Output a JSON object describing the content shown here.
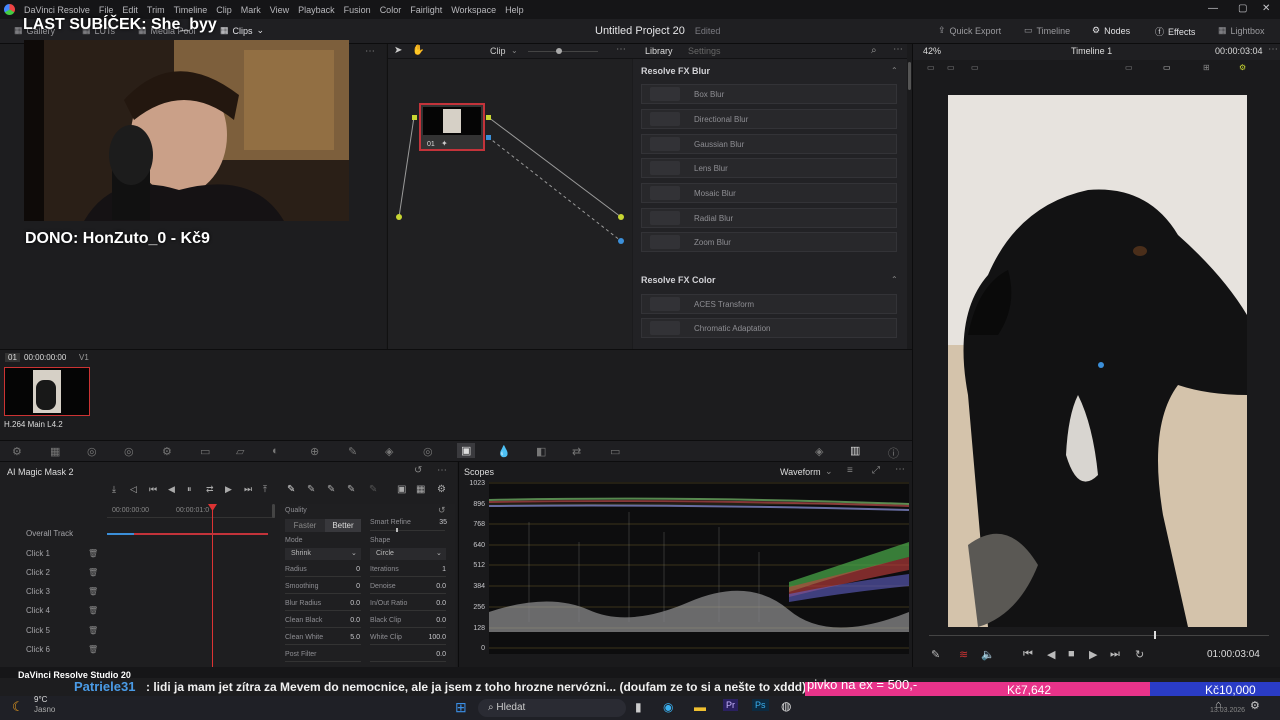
{
  "menubar": {
    "app": "DaVinci Resolve",
    "items": [
      "File",
      "Edit",
      "Trim",
      "Timeline",
      "Clip",
      "Mark",
      "View",
      "Playback",
      "Fusion",
      "Color",
      "Fairlight",
      "Workspace",
      "Help"
    ]
  },
  "toolbar": {
    "gallery": "Gallery",
    "luts": "LUTs",
    "media_pool": "Media Pool",
    "clips": "Clips",
    "project_title": "Untitled Project 20",
    "status": "Edited",
    "quick_export": "Quick Export",
    "timeline": "Timeline",
    "nodes": "Nodes",
    "effects": "Effects",
    "lightbox": "Lightbox"
  },
  "overlay": {
    "last_sub": "LAST SUBÍČEK: She_byy",
    "dono": "DONO: HonZuto_0 - Kč9"
  },
  "node_editor": {
    "mode": "Clip",
    "node_label": "01"
  },
  "library": {
    "tab_library": "Library",
    "tab_settings": "Settings",
    "cat_blur": "Resolve FX Blur",
    "blur": [
      "Box Blur",
      "Directional Blur",
      "Gaussian Blur",
      "Lens Blur",
      "Mosaic Blur",
      "Radial Blur",
      "Zoom Blur"
    ],
    "cat_color": "Resolve FX Color",
    "color": [
      "ACES Transform",
      "Chromatic Adaptation"
    ]
  },
  "viewer": {
    "zoom": "42%",
    "timeline": "Timeline 1",
    "timecode": "00:00:03:04",
    "playback_tc": "01:00:03:04"
  },
  "clip": {
    "index": "01",
    "tc": "00:00:00:00",
    "track": "V1",
    "codec": "H.264 Main L4.2"
  },
  "mask": {
    "title": "AI Magic Mask 2",
    "tc_start": "00:00:00:00",
    "tc_mid": "00:00:01:0",
    "tracks": [
      "Overall Track",
      "Click 1",
      "Click 2",
      "Click 3",
      "Click 4",
      "Click 5",
      "Click 6"
    ],
    "quality": "Quality",
    "faster": "Faster",
    "better": "Better",
    "smart_refine": "Smart Refine",
    "smart_refine_val": "35",
    "mode": "Mode",
    "shape": "Shape",
    "mode_val": "Shrink",
    "shape_val": "Circle",
    "params": [
      [
        "Radius",
        "0",
        "Iterations",
        "1"
      ],
      [
        "Smoothing",
        "0",
        "Denoise",
        "0.0"
      ],
      [
        "Blur Radius",
        "0.0",
        "In/Out Ratio",
        "0.0"
      ],
      [
        "Clean Black",
        "0.0",
        "Black Clip",
        "0.0"
      ],
      [
        "Clean White",
        "5.0",
        "White Clip",
        "100.0"
      ],
      [
        "Post Filter",
        "",
        "",
        "0.0"
      ]
    ]
  },
  "scopes": {
    "title": "Scopes",
    "type": "Waveform",
    "scale": [
      "1023",
      "896",
      "768",
      "640",
      "512",
      "384",
      "256",
      "128",
      "0"
    ]
  },
  "ticker": {
    "brand": "DaVinci Resolve Studio 20",
    "user": "Patriele31",
    "message": ": lidi ja mam jet zítra za Mevem do nemocnice, ale ja jsem z toho hrozne nervózni... (doufam ze to si a nešte to xddd)",
    "pivo": "pivko na ex = 500,-",
    "goal1": "Kč7,642",
    "goal2": "Kč10,000"
  },
  "taskbar": {
    "weather_temp": "9°C",
    "weather_desc": "Jasno",
    "search": "Hledat",
    "date": "13.03.2026"
  }
}
